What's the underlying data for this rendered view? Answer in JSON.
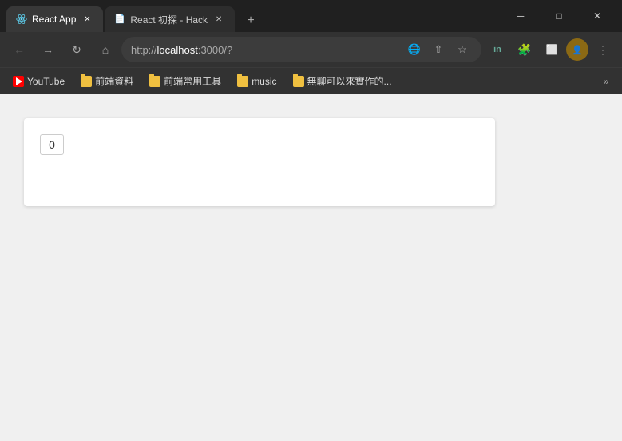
{
  "titlebar": {
    "tabs": [
      {
        "id": "tab-react-app",
        "title": "React App",
        "favicon_type": "react",
        "active": true
      },
      {
        "id": "tab-react-initial",
        "title": "React 初探 - Hack",
        "favicon_type": "document",
        "active": false
      }
    ],
    "new_tab_label": "+",
    "window_controls": {
      "minimize": "─",
      "maximize": "□",
      "close": "✕"
    }
  },
  "navbar": {
    "back_title": "Back",
    "forward_title": "Forward",
    "reload_title": "Reload",
    "home_title": "Home",
    "url_scheme": "http://",
    "url_host": "localhost",
    "url_path": ":3000/?",
    "translate_icon": "🌐",
    "share_icon": "⬆",
    "favorite_icon": "☆",
    "profile_label": "in",
    "extensions_icon": "🧩",
    "split_icon": "⬜",
    "profile_icon": "👤",
    "more_icon": "⋮"
  },
  "bookmarks": {
    "items": [
      {
        "id": "bm-youtube",
        "label": "YouTube",
        "favicon_type": "youtube"
      },
      {
        "id": "bm-frontend-data",
        "label": "前端資料",
        "favicon_type": "folder"
      },
      {
        "id": "bm-frontend-tools",
        "label": "前端常用工具",
        "favicon_type": "folder"
      },
      {
        "id": "bm-music",
        "label": "music",
        "favicon_type": "folder"
      },
      {
        "id": "bm-boring",
        "label": "無聊可以來實作的...",
        "favicon_type": "folder"
      }
    ],
    "more_label": "»"
  },
  "page": {
    "counter_value": "0"
  }
}
